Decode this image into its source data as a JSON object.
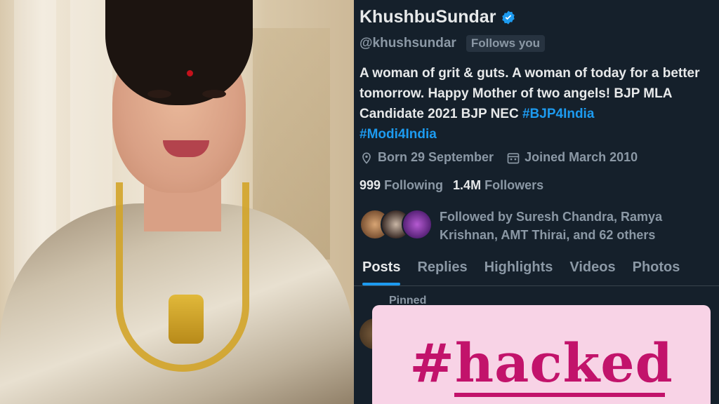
{
  "profile": {
    "display_name": "KhushbuSundar",
    "verified_icon": "verified-badge-icon",
    "handle": "@khushsundar",
    "follows_you": "Follows you",
    "bio_text": "A woman of grit & guts. A woman of today for a better tomorrow. Happy Mother of two angels! BJP MLA Candidate 2021 BJP NEC ",
    "bio_tag1": "#BJP4India",
    "bio_tag2": "#Modi4India",
    "born": "Born 29 September",
    "joined": "Joined March 2010",
    "following_count": "999",
    "following_label": "Following",
    "followers_count": "1.4M",
    "followers_label": "Followers",
    "followed_by": "Followed by Suresh Chandra, Ramya Krishnan, AMT Thirai, and 62 others"
  },
  "tabs": [
    {
      "label": "Posts"
    },
    {
      "label": "Replies"
    },
    {
      "label": "Highlights"
    },
    {
      "label": "Videos"
    },
    {
      "label": "Photos"
    }
  ],
  "pinned_label": "Pinned",
  "overlay": {
    "text": "#hacked"
  },
  "colors": {
    "background": "#15202b",
    "accent": "#1d9bf0",
    "overlay_bg": "#f8d3e6",
    "overlay_text": "#c2136b"
  }
}
